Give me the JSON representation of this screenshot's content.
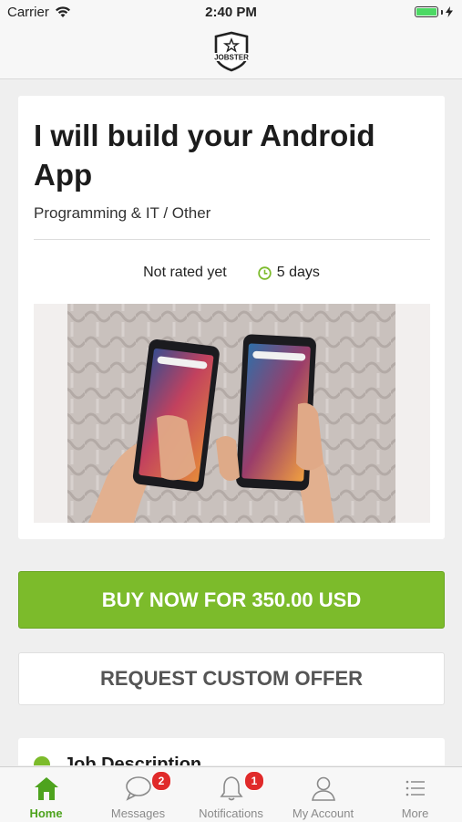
{
  "status_bar": {
    "carrier": "Carrier",
    "time": "2:40 PM"
  },
  "nav": {
    "logo_text": "JOBSTER"
  },
  "job": {
    "title": "I will build your Android App",
    "category": "Programming & IT / Other",
    "rating": "Not rated yet",
    "delivery": "5 days",
    "image_description": "two Android phones held in hands"
  },
  "actions": {
    "buy_label": "BUY NOW FOR 350.00 USD",
    "offer_label": "REQUEST CUSTOM OFFER"
  },
  "description": {
    "title": "Job Description"
  },
  "tabbar": {
    "tabs": [
      {
        "label": "Home",
        "icon": "home-icon",
        "active": true
      },
      {
        "label": "Messages",
        "icon": "chat-icon",
        "badge": "2"
      },
      {
        "label": "Notifications",
        "icon": "bell-icon",
        "badge": "1"
      },
      {
        "label": "My Account",
        "icon": "user-icon"
      },
      {
        "label": "More",
        "icon": "menu-icon"
      }
    ]
  },
  "colors": {
    "accent": "#7cbb2b",
    "badge": "#e02a2a",
    "active_tab": "#4ea31e"
  }
}
